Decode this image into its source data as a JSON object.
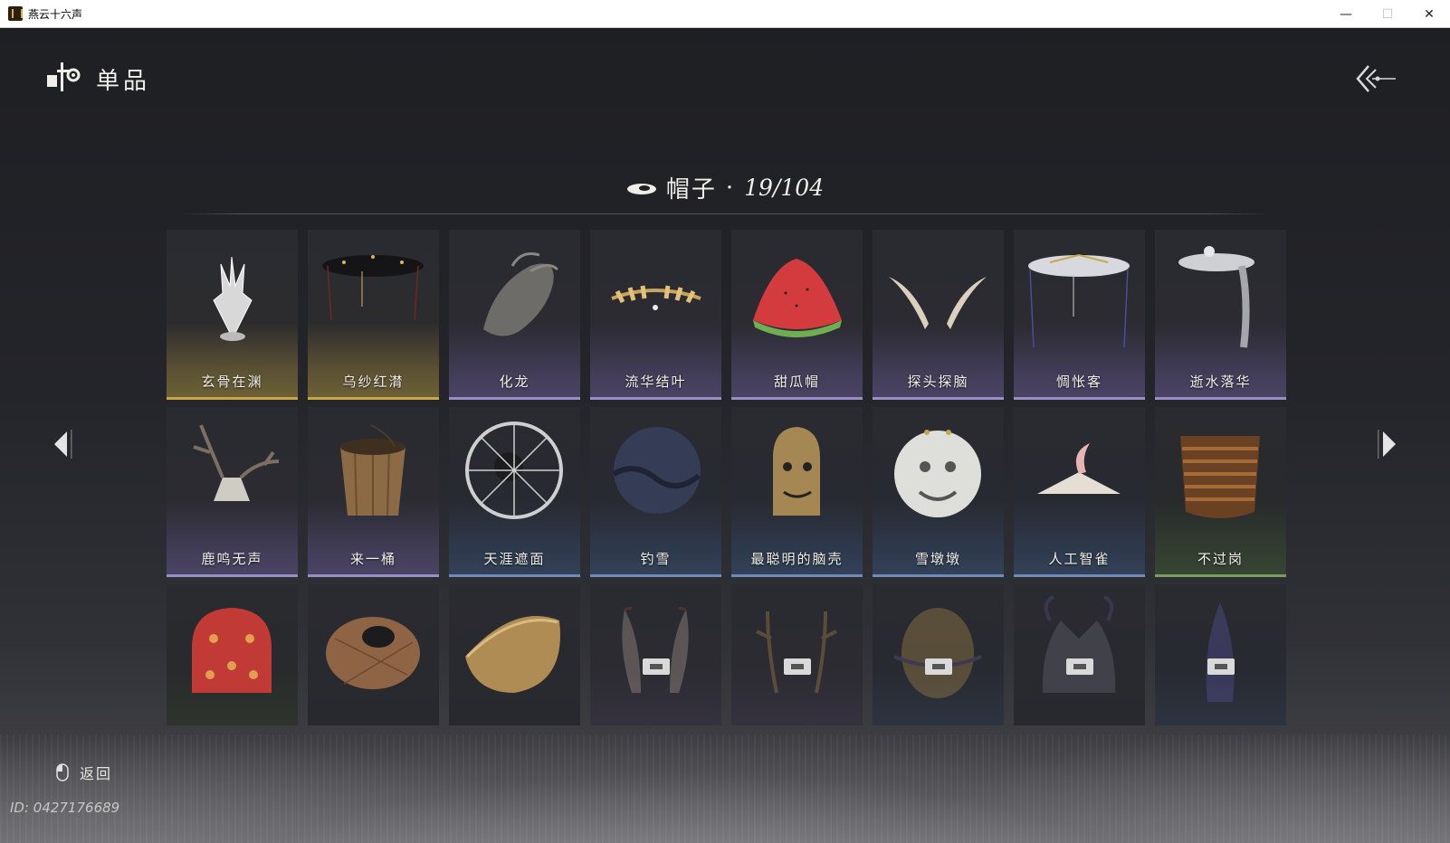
{
  "window": {
    "title": "燕云十六声",
    "minimize": "—",
    "maximize": "☐",
    "close": "✕"
  },
  "header": {
    "title": "单品"
  },
  "category": {
    "name": "帽子",
    "separator": "·",
    "count": "19/104"
  },
  "items": [
    {
      "name": "玄骨在渊",
      "rarity": "gold",
      "icon": "white-bone-crown-icon"
    },
    {
      "name": "乌纱红潸",
      "rarity": "gold",
      "icon": "black-veiled-hat-icon"
    },
    {
      "name": "化龙",
      "rarity": "purple",
      "icon": "dragon-head-icon"
    },
    {
      "name": "流华结叶",
      "rarity": "purple",
      "icon": "golden-laurel-icon"
    },
    {
      "name": "甜瓜帽",
      "rarity": "purple",
      "icon": "watermelon-hat-icon"
    },
    {
      "name": "探头探脑",
      "rarity": "purple",
      "icon": "feather-antennae-icon"
    },
    {
      "name": "惆怅客",
      "rarity": "purple",
      "icon": "white-veiled-hat-icon"
    },
    {
      "name": "逝水落华",
      "rarity": "purple",
      "icon": "silver-crown-veil-icon"
    },
    {
      "name": "鹿鸣无声",
      "rarity": "purple",
      "icon": "deer-skull-icon"
    },
    {
      "name": "来一桶",
      "rarity": "purple",
      "icon": "wooden-bucket-icon"
    },
    {
      "name": "天涯遮面",
      "rarity": "blue",
      "icon": "wheel-veil-icon"
    },
    {
      "name": "钓雪",
      "rarity": "blue",
      "icon": "dark-cloth-hood-icon"
    },
    {
      "name": "最聪明的脑壳",
      "rarity": "blue",
      "icon": "golden-bell-head-icon"
    },
    {
      "name": "雪墩墩",
      "rarity": "blue",
      "icon": "white-lion-head-icon"
    },
    {
      "name": "人工智雀",
      "rarity": "blue",
      "icon": "bird-hat-icon"
    },
    {
      "name": "不过岗",
      "rarity": "green",
      "icon": "stacked-bowls-icon"
    },
    {
      "name": "",
      "rarity": "plain-green",
      "icon": "red-floral-cap-icon"
    },
    {
      "name": "",
      "rarity": "plain",
      "icon": "woven-basket-mask-icon"
    },
    {
      "name": "",
      "rarity": "plain",
      "icon": "woven-bowl-hat-icon"
    },
    {
      "name": "",
      "rarity": "plain-purple",
      "icon": "red-horns-icon",
      "locked": true
    },
    {
      "name": "",
      "rarity": "plain-purple",
      "icon": "antler-crown-icon",
      "locked": true
    },
    {
      "name": "",
      "rarity": "plain-blue",
      "icon": "golden-mask-icon",
      "locked": true
    },
    {
      "name": "",
      "rarity": "plain",
      "icon": "dark-beast-head-icon",
      "locked": true
    },
    {
      "name": "",
      "rarity": "plain-blue",
      "icon": "purple-plume-icon",
      "locked": true
    }
  ],
  "footer": {
    "back_label": "返回",
    "player_id": "ID: 0427176689"
  },
  "colors": {
    "gold": "#c9a64a",
    "purple": "#9b8ec4",
    "blue": "#6f8cb6",
    "green": "#7c9c5e"
  }
}
